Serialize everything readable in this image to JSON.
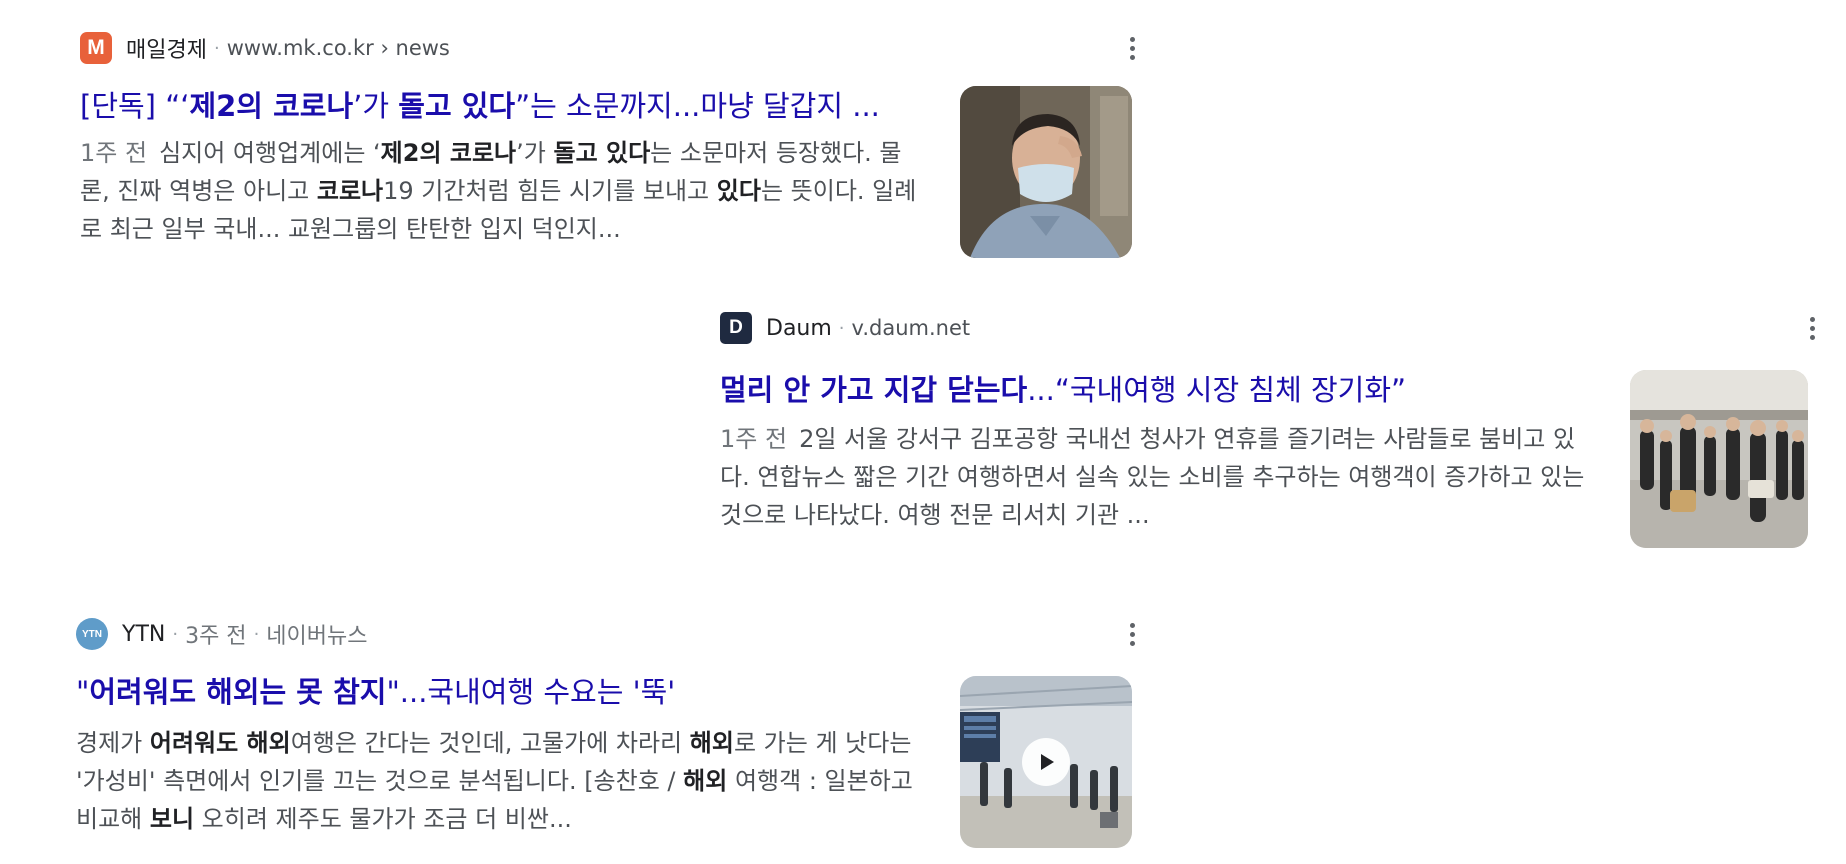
{
  "results": [
    {
      "source": "매일경제",
      "favicon_letter": "M",
      "url": "www.mk.co.kr › news",
      "title": {
        "p1": "[단독] “‘",
        "b1": "제2의 코로나",
        "p2": "’가 ",
        "b2": "돌고 있다",
        "p3": "”는 소문까지...마냥 달갑지 ..."
      },
      "snippet": {
        "date": "1주 전",
        "p1": "심지어 여행업계에는 ‘",
        "b1": "제2의 코로나",
        "p2": "’가 ",
        "b2": "돌고 있다",
        "p3": "는 소문마저 등장했다. 물론, 진짜 역병은 아니고 ",
        "b3": "코로나",
        "p4": "19 기간처럼 힘든 시기를 보내고 ",
        "b4": "있다",
        "p5": "는 뜻이다. 일례로 최근 일부 국내... 교원그룹의 탄탄한 입지 덕인지..."
      },
      "thumbnail": "man-wearing-mask-image"
    },
    {
      "source": "Daum",
      "favicon_letter": "D",
      "url": "v.daum.net",
      "title": {
        "p1": "",
        "b1": "멀리 안 가고 지갑 닫는다",
        "p2": "...“국내여행 시장 침체 장기화”"
      },
      "snippet": {
        "date": "1주 전",
        "p1": "2일 서울 강서구 김포공항 국내선 청사가 연휴를 즐기려는 사람들로 붐비고 있다. 연합뉴스 짧은 기간 여행하면서 실속 있는 소비를 추구하는 여행객이 증가하고 있는 것으로 나타났다. 여행 전문 리서치 기관 ..."
      },
      "thumbnail": "airport-crowd-image"
    },
    {
      "source": "YTN",
      "favicon_letter": "YTN",
      "time": "3주 전",
      "via": "네이버뉴스",
      "title": {
        "p1": "\"",
        "b1": "어려워도 해외는 못 참지",
        "p2": "\"...국내여행 수요는 '뚝'"
      },
      "snippet": {
        "p1": "경제가 ",
        "b1": "어려워도 해외",
        "p2": "여행은 간다는 것인데, 고물가에 차라리 ",
        "b2": "해외",
        "p3": "로 가는 게 낫다는 '가성비' 측면에서 인기를 끄는 것으로 분석됩니다. [송찬호 / ",
        "b3": "해외",
        "p4": " 여행객 : 일본하고 비교해 ",
        "b4": "보니",
        "p5": " 오히려 제주도 물가가 조금 더 비싼..."
      },
      "thumbnail": "airport-terminal-video",
      "play_icon": "play-icon"
    }
  ],
  "colors": {
    "link": "#1a0dab",
    "snippet": "#4d5156",
    "meta": "#70757a"
  }
}
